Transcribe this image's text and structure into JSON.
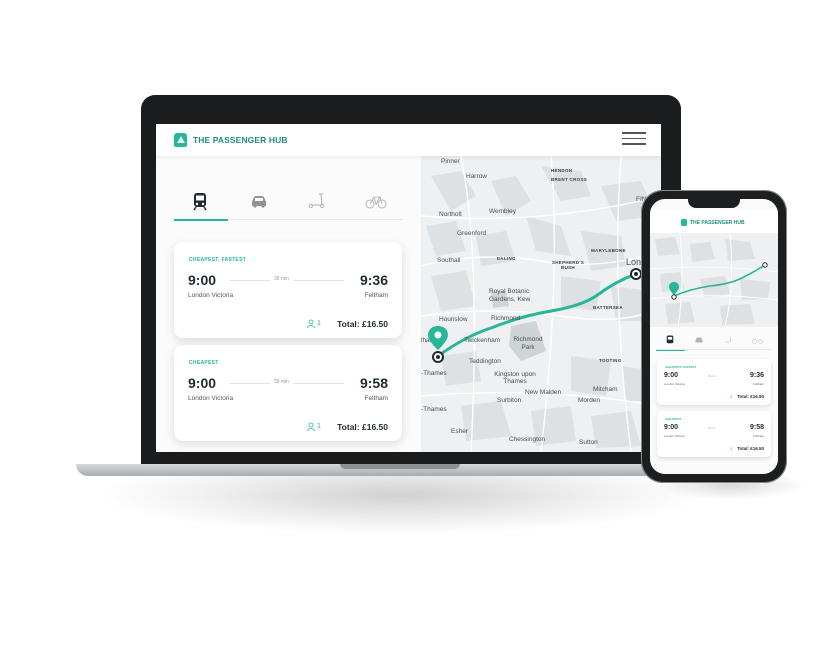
{
  "brand": {
    "name": "THE PASSENGER HUB",
    "accent": "#27b69a"
  },
  "header": {
    "menu_icon": "hamburger-icon"
  },
  "transport_modes": [
    {
      "icon": "train-icon",
      "active": true
    },
    {
      "icon": "car-icon",
      "active": false
    },
    {
      "icon": "scooter-icon",
      "active": false
    },
    {
      "icon": "bicycle-icon",
      "active": false
    }
  ],
  "routes": [
    {
      "tag": "CHEAPEST, FASTEST",
      "depart_time": "9:00",
      "arrive_time": "9:36",
      "duration": "36 min",
      "from": "London Victoria",
      "to": "Feltham",
      "passengers": "1",
      "total": "Total: £16.50"
    },
    {
      "tag": "CHEAPEST",
      "depart_time": "9:00",
      "arrive_time": "9:58",
      "duration": "58 min",
      "from": "London Victoria",
      "to": "Feltham",
      "passengers": "1",
      "total": "Total: £16.50"
    }
  ],
  "map": {
    "labels": {
      "pinner": "Pinner",
      "harrow": "Harrow",
      "hendon": "HENDON",
      "brent_cross": "BRENT CROSS",
      "northolt": "Northolt",
      "wembley": "Wembley",
      "greenford": "Greenford",
      "southall": "Southall",
      "ealing": "EALING",
      "shepherds_bush": "SHEPHERD'S BUSH",
      "marylebone": "MARYLEBONE",
      "london": "London",
      "kew": "Royal Botanic Gardens, Kew",
      "richmond": "Richmond",
      "battersea": "BATTERSEA",
      "hounslow": "Hounslow",
      "twickenham": "Twickenham",
      "richmond_park": "Richmond Park",
      "teddington": "Teddington",
      "tooting": "TOOTING",
      "thames": "-Thames",
      "kingston": "Kingston upon Thames",
      "new_malden": "New Malden",
      "mitcham": "Mitcham",
      "surbiton": "Surbiton",
      "morden": "Morden",
      "thames2": "-Thames",
      "esher": "Esher",
      "chessington": "Chessington",
      "sutton": "Sutton",
      "finchley": "FINC",
      "thames_left": "lham"
    },
    "route_color": "#27b69a"
  }
}
